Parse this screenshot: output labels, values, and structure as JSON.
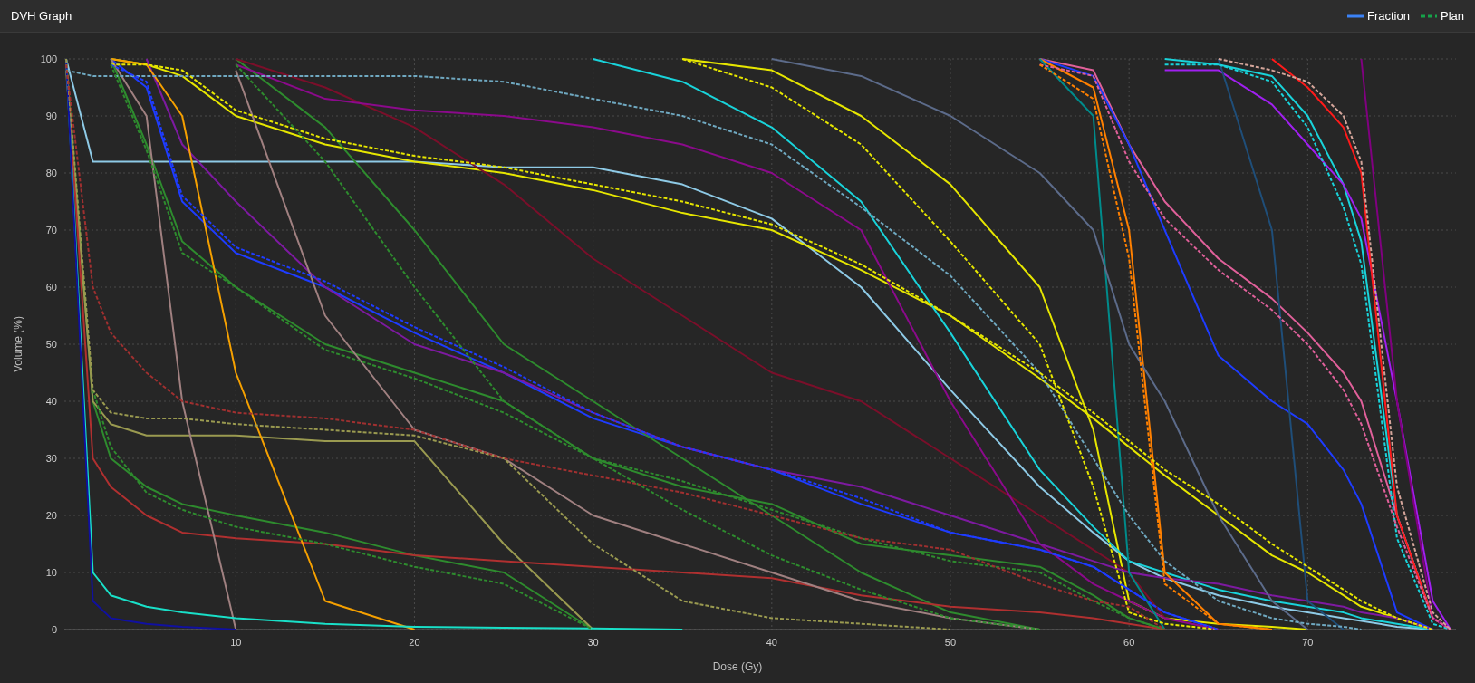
{
  "header": {
    "title": "DVH Graph"
  },
  "legend": [
    {
      "label": "Fraction",
      "kind": "fraction",
      "color": "#3b82f6"
    },
    {
      "label": "Plan",
      "kind": "plan",
      "color": "#16a34a"
    }
  ],
  "chart_data": {
    "type": "line",
    "xlabel": "Dose (Gy)",
    "ylabel": "Volume (%)",
    "xlim": [
      0.4,
      78.3
    ],
    "ylim": [
      0,
      100
    ],
    "grid": true,
    "xticks": [
      10,
      20,
      30,
      40,
      50,
      60,
      70
    ],
    "yticks": [
      0,
      10,
      20,
      30,
      40,
      50,
      60,
      70,
      80,
      90,
      100
    ],
    "x": [
      0.5,
      2,
      3,
      5,
      7,
      10,
      15,
      20,
      25,
      30,
      35,
      40,
      45,
      50,
      55,
      58,
      60,
      62,
      65,
      68,
      70,
      72,
      73,
      75,
      77,
      78
    ],
    "series": [
      {
        "line_style": "solid",
        "color": "#8ecae6",
        "values": [
          100,
          82,
          82,
          82,
          82,
          82,
          82,
          82,
          81,
          81,
          78,
          72,
          60,
          42,
          25,
          17,
          12,
          9,
          6,
          4,
          3,
          2,
          1.5,
          0.5,
          0,
          null
        ]
      },
      {
        "line_style": "dashed",
        "color": "#6fa8c0",
        "values": [
          98,
          97,
          97,
          97,
          97,
          97,
          97,
          97,
          96,
          93,
          90,
          85,
          74,
          62,
          45,
          30,
          20,
          12,
          5,
          2,
          1,
          0.5,
          0,
          null,
          null,
          null
        ]
      },
      {
        "line_style": "solid",
        "color": "#e6e600",
        "values": [
          null,
          null,
          100,
          99,
          97,
          90,
          85,
          82,
          80,
          77,
          73,
          70,
          63,
          55,
          44,
          37,
          32,
          27,
          20,
          13,
          10,
          6,
          4,
          2,
          0,
          null
        ]
      },
      {
        "line_style": "dashed",
        "color": "#e6e600",
        "values": [
          null,
          null,
          99,
          99,
          98,
          91,
          86,
          83,
          81,
          78,
          75,
          71,
          64,
          55,
          45,
          38,
          33,
          28,
          22,
          15,
          11,
          7,
          5,
          2,
          0,
          null
        ]
      },
      {
        "line_style": "solid",
        "color": "#e6e600",
        "values": [
          null,
          null,
          null,
          null,
          null,
          null,
          null,
          null,
          null,
          null,
          100,
          98,
          90,
          78,
          60,
          35,
          5,
          2,
          1,
          0.5,
          0,
          null,
          null,
          null,
          null,
          null
        ]
      },
      {
        "line_style": "dashed",
        "color": "#e6e600",
        "values": [
          null,
          null,
          null,
          null,
          null,
          null,
          null,
          null,
          null,
          null,
          100,
          95,
          85,
          68,
          50,
          25,
          3,
          1,
          0,
          null,
          null,
          null,
          null,
          null,
          null,
          null
        ]
      },
      {
        "line_style": "solid",
        "color": "#19d3da",
        "values": [
          null,
          null,
          null,
          null,
          null,
          null,
          null,
          null,
          null,
          100,
          96,
          88,
          75,
          52,
          28,
          18,
          12,
          10,
          7,
          5,
          4,
          3,
          2,
          1,
          0,
          null
        ]
      },
      {
        "line_style": "solid",
        "color": "#19d3da",
        "values": [
          null,
          null,
          null,
          null,
          null,
          null,
          null,
          null,
          null,
          null,
          null,
          null,
          null,
          null,
          null,
          null,
          null,
          100,
          99,
          97,
          90,
          78,
          68,
          20,
          2,
          0
        ]
      },
      {
        "line_style": "dashed",
        "color": "#19d3da",
        "values": [
          null,
          null,
          null,
          null,
          null,
          null,
          null,
          null,
          null,
          null,
          null,
          null,
          null,
          null,
          null,
          null,
          null,
          99,
          99,
          96,
          88,
          74,
          64,
          16,
          1,
          0
        ]
      },
      {
        "line_style": "solid",
        "color": "#e0609a",
        "values": [
          null,
          null,
          null,
          null,
          null,
          null,
          null,
          null,
          null,
          null,
          null,
          null,
          null,
          null,
          100,
          98,
          85,
          75,
          65,
          58,
          52,
          45,
          40,
          20,
          2,
          0
        ]
      },
      {
        "line_style": "dashed",
        "color": "#e0609a",
        "values": [
          null,
          null,
          null,
          null,
          null,
          null,
          null,
          null,
          null,
          null,
          null,
          null,
          null,
          null,
          99,
          97,
          82,
          72,
          63,
          56,
          50,
          42,
          36,
          18,
          2,
          0
        ]
      },
      {
        "line_style": "solid",
        "color": "#1e3cff",
        "values": [
          null,
          null,
          100,
          95,
          75,
          66,
          60,
          52,
          45,
          37,
          32,
          28,
          22,
          17,
          14,
          11,
          7,
          3,
          0,
          null,
          null,
          null,
          null,
          null,
          null,
          null
        ]
      },
      {
        "line_style": "dashed",
        "color": "#1e3cff",
        "values": [
          null,
          null,
          99,
          96,
          76,
          67,
          61,
          53,
          46,
          38,
          32,
          28,
          23,
          17,
          14,
          11,
          7,
          3,
          0,
          null,
          null,
          null,
          null,
          null,
          null,
          null
        ]
      },
      {
        "line_style": "solid",
        "color": "#1e3cff",
        "values": [
          null,
          null,
          null,
          null,
          null,
          null,
          null,
          null,
          null,
          null,
          null,
          null,
          null,
          null,
          100,
          97,
          85,
          70,
          48,
          40,
          36,
          28,
          22,
          3,
          0,
          null
        ]
      },
      {
        "line_style": "solid",
        "color": "#2e8b2e",
        "values": [
          null,
          null,
          100,
          85,
          68,
          60,
          50,
          45,
          40,
          30,
          25,
          22,
          15,
          13,
          11,
          6,
          2,
          0,
          null,
          null,
          null,
          null,
          null,
          null,
          null,
          null
        ]
      },
      {
        "line_style": "dashed",
        "color": "#2e8b2e",
        "values": [
          null,
          null,
          99,
          84,
          66,
          60,
          49,
          44,
          38,
          30,
          26,
          21,
          16,
          12,
          10,
          5,
          2,
          0,
          null,
          null,
          null,
          null,
          null,
          null,
          null,
          null
        ]
      },
      {
        "line_style": "solid",
        "color": "#2e8b2e",
        "values": [
          100,
          40,
          30,
          25,
          22,
          20,
          17,
          13,
          10,
          0,
          null,
          null,
          null,
          null,
          null,
          null,
          null,
          null,
          null,
          null,
          null,
          null,
          null,
          null,
          null,
          null
        ]
      },
      {
        "line_style": "dashed",
        "color": "#2e8b2e",
        "values": [
          null,
          42,
          32,
          24,
          21,
          18,
          15,
          11,
          8,
          0,
          null,
          null,
          null,
          null,
          null,
          null,
          null,
          null,
          null,
          null,
          null,
          null,
          null,
          null,
          null,
          null
        ]
      },
      {
        "line_style": "solid",
        "color": "#2e8b2e",
        "values": [
          null,
          null,
          null,
          null,
          null,
          100,
          88,
          70,
          50,
          40,
          30,
          20,
          10,
          3,
          0,
          null,
          null,
          null,
          null,
          null,
          null,
          null,
          null,
          null,
          null,
          null
        ]
      },
      {
        "line_style": "dashed",
        "color": "#2e8b2e",
        "values": [
          null,
          null,
          null,
          null,
          null,
          99,
          82,
          60,
          40,
          30,
          21,
          13,
          7,
          2,
          0,
          null,
          null,
          null,
          null,
          null,
          null,
          null,
          null,
          null,
          null,
          null
        ]
      },
      {
        "line_style": "solid",
        "color": "#9a9a50",
        "values": [
          98,
          40,
          36,
          34,
          34,
          34,
          33,
          33,
          15,
          0,
          null,
          null,
          null,
          null,
          null,
          null,
          null,
          null,
          null,
          null,
          null,
          null,
          null,
          null,
          null,
          null
        ]
      },
      {
        "line_style": "dashed",
        "color": "#9a9a50",
        "values": [
          100,
          42,
          38,
          37,
          37,
          36,
          35,
          34,
          30,
          15,
          5,
          2,
          1,
          0,
          null,
          null,
          null,
          null,
          null,
          null,
          null,
          null,
          null,
          null,
          null,
          null
        ]
      },
      {
        "line_style": "solid",
        "color": "#b03030",
        "values": [
          100,
          30,
          25,
          20,
          17,
          16,
          15,
          13,
          12,
          11,
          10,
          9,
          6,
          4,
          3,
          2,
          1,
          0,
          null,
          null,
          null,
          null,
          null,
          null,
          null,
          null
        ]
      },
      {
        "line_style": "dashed",
        "color": "#a03030",
        "values": [
          99,
          60,
          52,
          45,
          40,
          38,
          37,
          35,
          30,
          27,
          24,
          20,
          16,
          14,
          8,
          5,
          4,
          0,
          null,
          null,
          null,
          null,
          null,
          null,
          null,
          null
        ]
      },
      {
        "line_style": "solid",
        "color": "#7a0f2a",
        "values": [
          null,
          null,
          null,
          null,
          null,
          100,
          95,
          88,
          78,
          65,
          55,
          45,
          40,
          30,
          20,
          14,
          10,
          2,
          0,
          null,
          null,
          null,
          null,
          null,
          null,
          null
        ]
      },
      {
        "line_style": "solid",
        "color": "#8b0a8b",
        "values": [
          null,
          null,
          null,
          null,
          null,
          99,
          93,
          91,
          90,
          88,
          85,
          80,
          70,
          40,
          15,
          8,
          5,
          2,
          0,
          null,
          null,
          null,
          null,
          null,
          null,
          null
        ]
      },
      {
        "line_style": "solid",
        "color": "#7d1aa0",
        "values": [
          null,
          null,
          null,
          100,
          85,
          75,
          60,
          50,
          45,
          38,
          32,
          28,
          25,
          20,
          15,
          12,
          10,
          9,
          8,
          6,
          5,
          4,
          3,
          2,
          0,
          null
        ]
      },
      {
        "line_style": "solid",
        "color": "#a020f0",
        "values": [
          null,
          null,
          null,
          null,
          null,
          null,
          null,
          null,
          null,
          null,
          null,
          null,
          null,
          null,
          null,
          null,
          null,
          98,
          98,
          92,
          85,
          78,
          72,
          40,
          5,
          0
        ]
      },
      {
        "line_style": "solid",
        "color": "#ff1a1a",
        "values": [
          null,
          null,
          null,
          null,
          null,
          null,
          null,
          null,
          null,
          null,
          null,
          null,
          null,
          null,
          null,
          null,
          null,
          null,
          null,
          100,
          95,
          88,
          80,
          20,
          2,
          0
        ]
      },
      {
        "line_style": "dashed",
        "color": "#d4a59a",
        "values": [
          null,
          null,
          null,
          null,
          null,
          null,
          null,
          null,
          null,
          null,
          null,
          null,
          null,
          null,
          null,
          null,
          null,
          null,
          100,
          98,
          96,
          90,
          82,
          25,
          3,
          0
        ]
      },
      {
        "line_style": "solid",
        "color": "#f5a000",
        "values": [
          null,
          null,
          100,
          99,
          90,
          45,
          5,
          0,
          null,
          null,
          null,
          null,
          null,
          null,
          null,
          null,
          null,
          null,
          null,
          null,
          null,
          null,
          null,
          null,
          null,
          null
        ]
      },
      {
        "line_style": "solid",
        "color": "#ff8000",
        "values": [
          null,
          null,
          null,
          null,
          null,
          null,
          null,
          null,
          null,
          null,
          null,
          null,
          null,
          null,
          100,
          95,
          70,
          10,
          1,
          0,
          null,
          null,
          null,
          null,
          null,
          null
        ]
      },
      {
        "line_style": "dashed",
        "color": "#ff8000",
        "values": [
          null,
          null,
          null,
          null,
          null,
          null,
          null,
          null,
          null,
          null,
          null,
          null,
          null,
          null,
          99,
          93,
          65,
          8,
          1,
          0,
          null,
          null,
          null,
          null,
          null,
          null
        ]
      },
      {
        "line_style": "solid",
        "color": "#008b8b",
        "values": [
          null,
          null,
          null,
          null,
          null,
          null,
          null,
          null,
          null,
          null,
          null,
          null,
          null,
          null,
          100,
          90,
          10,
          0,
          null,
          null,
          null,
          null,
          null,
          null,
          null,
          null
        ]
      },
      {
        "line_style": "solid",
        "color": "#5c6b8a",
        "values": [
          null,
          null,
          null,
          null,
          null,
          null,
          null,
          null,
          null,
          null,
          null,
          100,
          97,
          90,
          80,
          70,
          50,
          40,
          20,
          5,
          0,
          null,
          null,
          null,
          null,
          null
        ]
      },
      {
        "line_style": "solid",
        "color": "#1f4e79",
        "values": [
          null,
          null,
          null,
          null,
          null,
          null,
          null,
          null,
          null,
          null,
          null,
          null,
          null,
          null,
          null,
          null,
          null,
          null,
          100,
          70,
          5,
          0,
          null,
          null,
          null,
          null
        ]
      },
      {
        "line_style": "solid",
        "color": "#a08080",
        "values": [
          null,
          null,
          100,
          90,
          40,
          0,
          null,
          null,
          null,
          null,
          null,
          null,
          null,
          null,
          null,
          null,
          null,
          null,
          null,
          null,
          null,
          null,
          null,
          null,
          null,
          null
        ]
      },
      {
        "line_style": "solid",
        "color": "#a08080",
        "values": [
          null,
          null,
          null,
          null,
          null,
          98,
          55,
          35,
          30,
          20,
          15,
          10,
          5,
          2,
          0,
          null,
          null,
          null,
          null,
          null,
          null,
          null,
          null,
          null,
          null,
          null
        ]
      },
      {
        "line_style": "solid",
        "color": "#19e0c8",
        "values": [
          100,
          10,
          6,
          4,
          3,
          2,
          1,
          0.5,
          0.3,
          0.2,
          0,
          null,
          null,
          null,
          null,
          null,
          null,
          null,
          null,
          null,
          null,
          null,
          null,
          null,
          null,
          null
        ]
      },
      {
        "line_style": "solid",
        "color": "#1010a0",
        "values": [
          100,
          5,
          2,
          1,
          0.5,
          0,
          null,
          null,
          null,
          null,
          null,
          null,
          null,
          null,
          null,
          null,
          null,
          null,
          null,
          null,
          null,
          null,
          null,
          null,
          null,
          null
        ]
      },
      {
        "line_style": "solid",
        "color": "#800080",
        "values": [
          null,
          null,
          null,
          null,
          null,
          null,
          null,
          null,
          null,
          null,
          null,
          null,
          null,
          null,
          null,
          null,
          null,
          null,
          null,
          null,
          null,
          null,
          100,
          40,
          2,
          0
        ]
      }
    ]
  }
}
